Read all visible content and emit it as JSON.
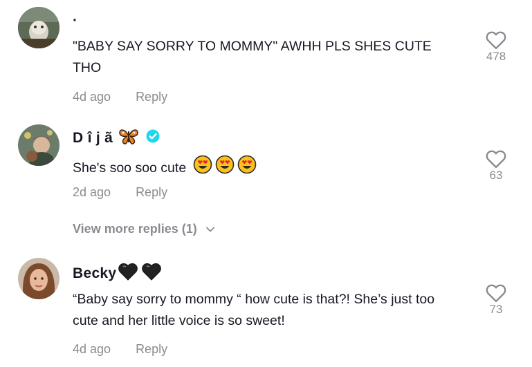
{
  "comments": [
    {
      "username": "·",
      "text": "\"BABY SAY SORRY TO MOMMY\" AWHH PLS SHES CUTE THO",
      "time": "4d ago",
      "reply_label": "Reply",
      "likes": "478"
    },
    {
      "username": "D î j ã",
      "text": "She's soo soo cute",
      "time": "2d ago",
      "reply_label": "Reply",
      "likes": "63"
    },
    {
      "username": "Becky",
      "text": "“Baby say sorry to mommy “ how cute is that?! She’s just too cute and her little voice is so sweet!",
      "time": "4d ago",
      "reply_label": "Reply",
      "likes": "73"
    }
  ],
  "view_more_replies": "View more replies (1)",
  "icons": {
    "like": "heart-outline-icon",
    "verified": "verified-badge-icon",
    "expand": "chevron-down-icon",
    "emoji_butterfly": "butterfly-emoji",
    "emoji_heart_eyes": "heart-eyes-emoji",
    "emoji_black_heart": "black-heart-emoji"
  },
  "colors": {
    "text": "#161823",
    "muted": "#8a8b91",
    "verified": "#20d5ec"
  }
}
